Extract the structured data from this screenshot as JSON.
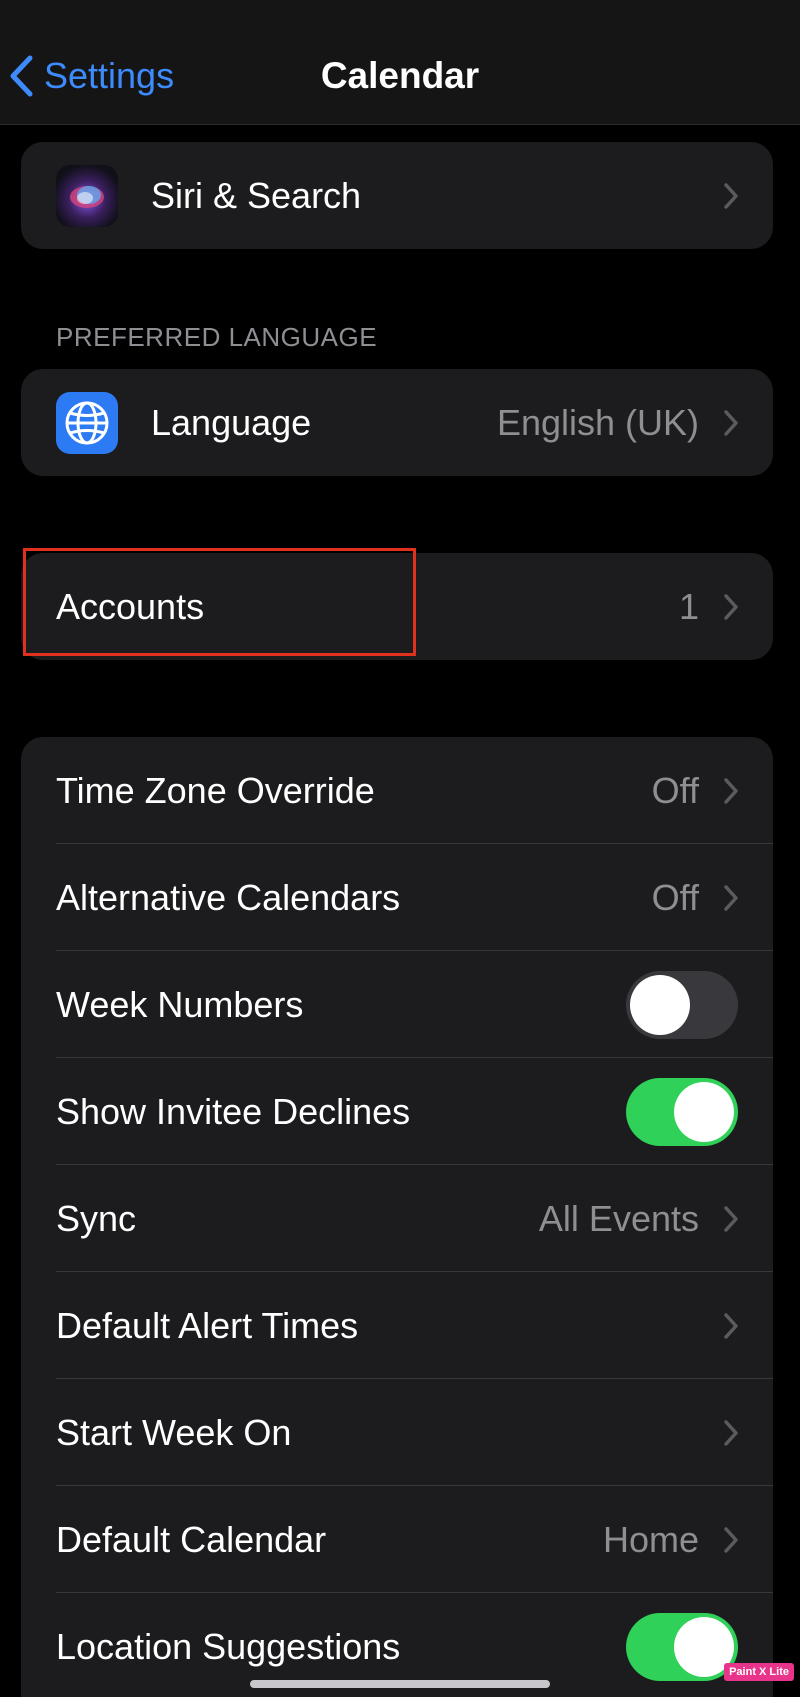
{
  "nav": {
    "back_label": "Settings",
    "title": "Calendar"
  },
  "siri_group": {
    "label": "Siri & Search",
    "icon": "siri-icon"
  },
  "preferred_language": {
    "header": "PREFERRED LANGUAGE",
    "label": "Language",
    "value": "English (UK)",
    "icon": "globe-icon"
  },
  "accounts": {
    "label": "Accounts",
    "value": "1"
  },
  "options": [
    {
      "label": "Time Zone Override",
      "value": "Off",
      "type": "link"
    },
    {
      "label": "Alternative Calendars",
      "value": "Off",
      "type": "link"
    },
    {
      "label": "Week Numbers",
      "type": "toggle",
      "on": false
    },
    {
      "label": "Show Invitee Declines",
      "type": "toggle",
      "on": true
    },
    {
      "label": "Sync",
      "value": "All Events",
      "type": "link"
    },
    {
      "label": "Default Alert Times",
      "value": "",
      "type": "link"
    },
    {
      "label": "Start Week On",
      "value": "",
      "type": "link"
    },
    {
      "label": "Default Calendar",
      "value": "Home",
      "type": "link"
    },
    {
      "label": "Location Suggestions",
      "type": "toggle",
      "on": true
    }
  ],
  "colors": {
    "background": "#000000",
    "cell": "#1c1c1e",
    "accent_blue": "#3d8bfd",
    "toggle_on": "#30d158",
    "toggle_off": "#39393d",
    "secondary_text": "#8e8e93",
    "highlight": "#e0301e"
  },
  "watermark": "Paint X Lite"
}
